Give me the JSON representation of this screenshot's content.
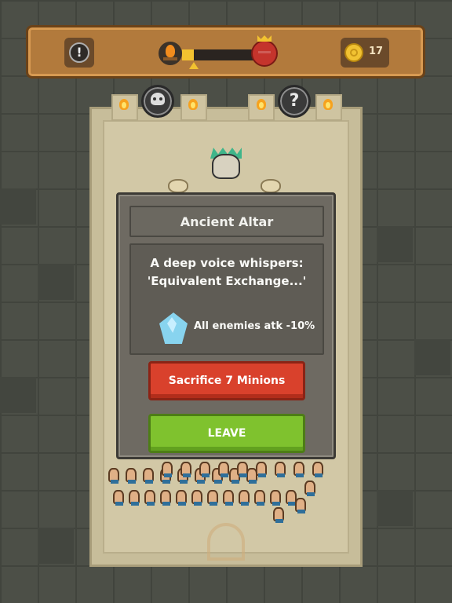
{
  "hud": {
    "alert_icon": "exclamation-icon",
    "alert_symbol": "!",
    "progress_fraction": 0.16,
    "start_icon": "campfire-icon",
    "boss_icon": "demon-king-icon",
    "coin_icon": "coin-icon",
    "coins": "17"
  },
  "room": {
    "left_icon": "skull-icon",
    "right_icon": "question-icon",
    "right_symbol": "?"
  },
  "event": {
    "title": "Ancient Altar",
    "message_line1": "A deep voice whispers:",
    "message_line2": "'Equivalent Exchange...'",
    "effect_icon": "crystal-icon",
    "effect_text": "All enemies atk -10%",
    "sacrifice_label": "Sacrifice 7 Minions",
    "leave_label": "LEAVE"
  },
  "colors": {
    "sacrifice": "#d9412c",
    "leave": "#7fc22e",
    "hud_wood": "#b27a3c",
    "progress": "#f2c230"
  }
}
